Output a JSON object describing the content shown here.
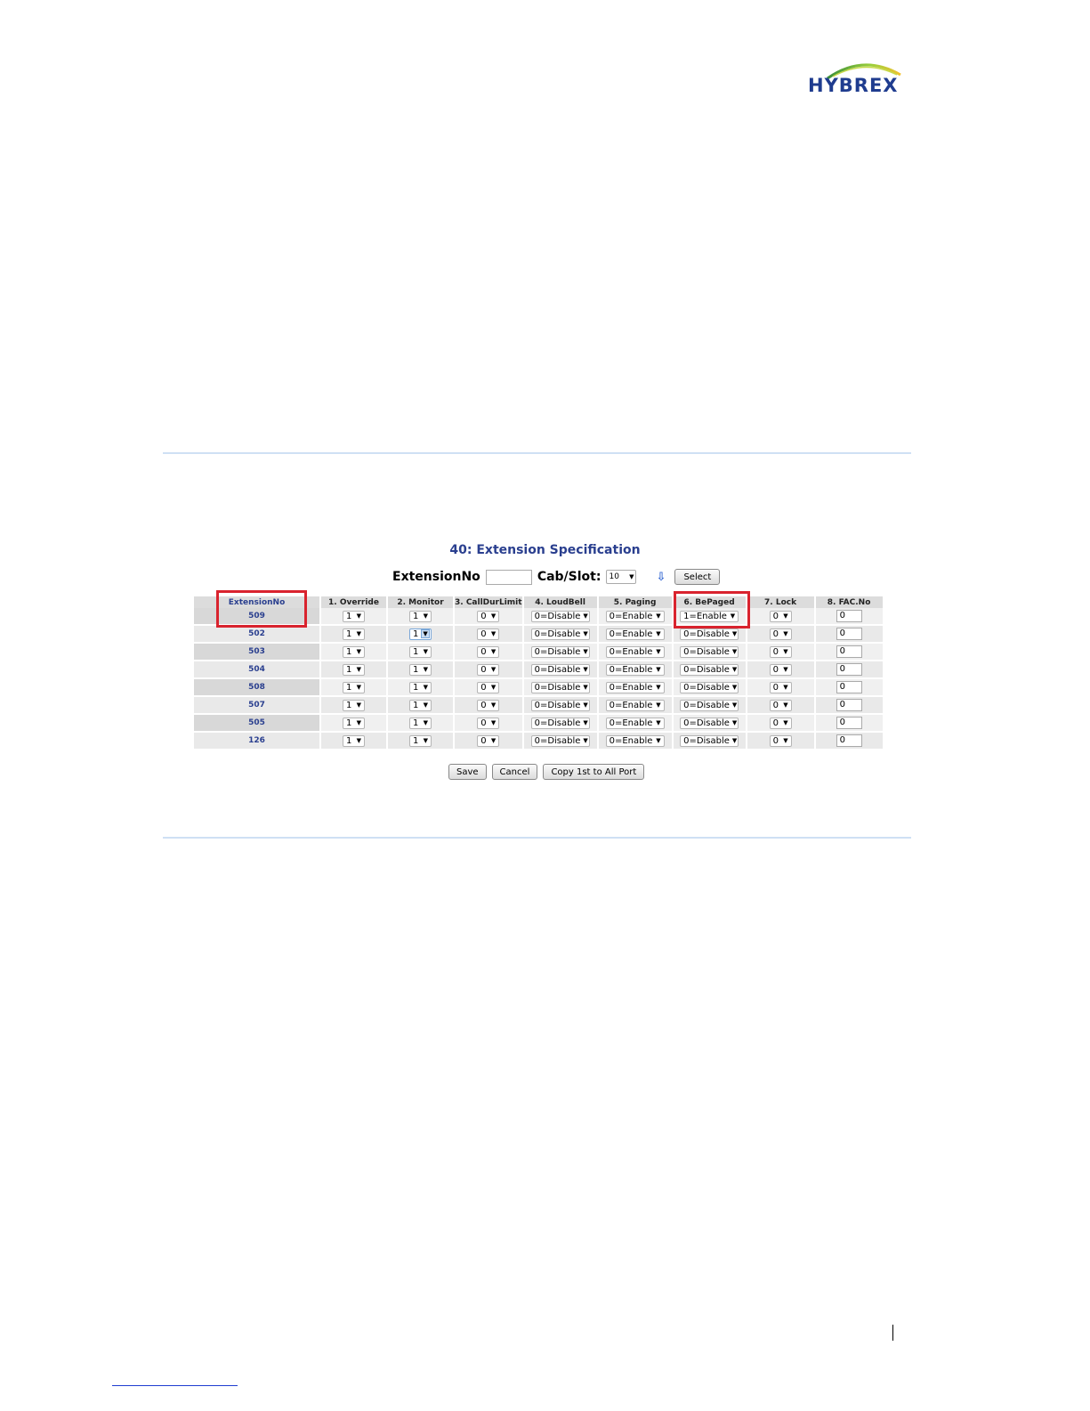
{
  "logo": {
    "text": "HYBREX"
  },
  "screen": {
    "title": "40: Extension Specification",
    "toolbar": {
      "extension_label": "ExtensionNo",
      "extension_value": "",
      "cabslot_label": "Cab/Slot:",
      "cabslot_value": "10",
      "select_label": "Select"
    },
    "columns": [
      "ExtensionNo",
      "1. Override",
      "2. Monitor",
      "3. CallDurLimit",
      "4. LoudBell",
      "5. Paging",
      "6. BePaged",
      "7. Lock",
      "8. FAC.No"
    ],
    "rows": [
      {
        "ext": "509",
        "override": "1",
        "monitor": "1",
        "calldur": "0",
        "loudbell": "0=Disable",
        "paging": "0=Enable",
        "bepaged": "1=Enable",
        "lock": "0",
        "fac": "0"
      },
      {
        "ext": "502",
        "override": "1",
        "monitor": "1",
        "calldur": "0",
        "loudbell": "0=Disable",
        "paging": "0=Enable",
        "bepaged": "0=Disable",
        "lock": "0",
        "fac": "0"
      },
      {
        "ext": "503",
        "override": "1",
        "monitor": "1",
        "calldur": "0",
        "loudbell": "0=Disable",
        "paging": "0=Enable",
        "bepaged": "0=Disable",
        "lock": "0",
        "fac": "0"
      },
      {
        "ext": "504",
        "override": "1",
        "monitor": "1",
        "calldur": "0",
        "loudbell": "0=Disable",
        "paging": "0=Enable",
        "bepaged": "0=Disable",
        "lock": "0",
        "fac": "0"
      },
      {
        "ext": "508",
        "override": "1",
        "monitor": "1",
        "calldur": "0",
        "loudbell": "0=Disable",
        "paging": "0=Enable",
        "bepaged": "0=Disable",
        "lock": "0",
        "fac": "0"
      },
      {
        "ext": "507",
        "override": "1",
        "monitor": "1",
        "calldur": "0",
        "loudbell": "0=Disable",
        "paging": "0=Enable",
        "bepaged": "0=Disable",
        "lock": "0",
        "fac": "0"
      },
      {
        "ext": "505",
        "override": "1",
        "monitor": "1",
        "calldur": "0",
        "loudbell": "0=Disable",
        "paging": "0=Enable",
        "bepaged": "0=Disable",
        "lock": "0",
        "fac": "0"
      },
      {
        "ext": "126",
        "override": "1",
        "monitor": "1",
        "calldur": "0",
        "loudbell": "0=Disable",
        "paging": "0=Enable",
        "bepaged": "0=Disable",
        "lock": "0",
        "fac": "0"
      }
    ],
    "actions": {
      "save": "Save",
      "cancel": "Cancel",
      "copy": "Copy 1st to All Port"
    }
  },
  "colors": {
    "title": "#2a3f8f",
    "highlight": "#d9232e",
    "rule": "#cfe0f4",
    "logo": "#1f3c8f"
  }
}
